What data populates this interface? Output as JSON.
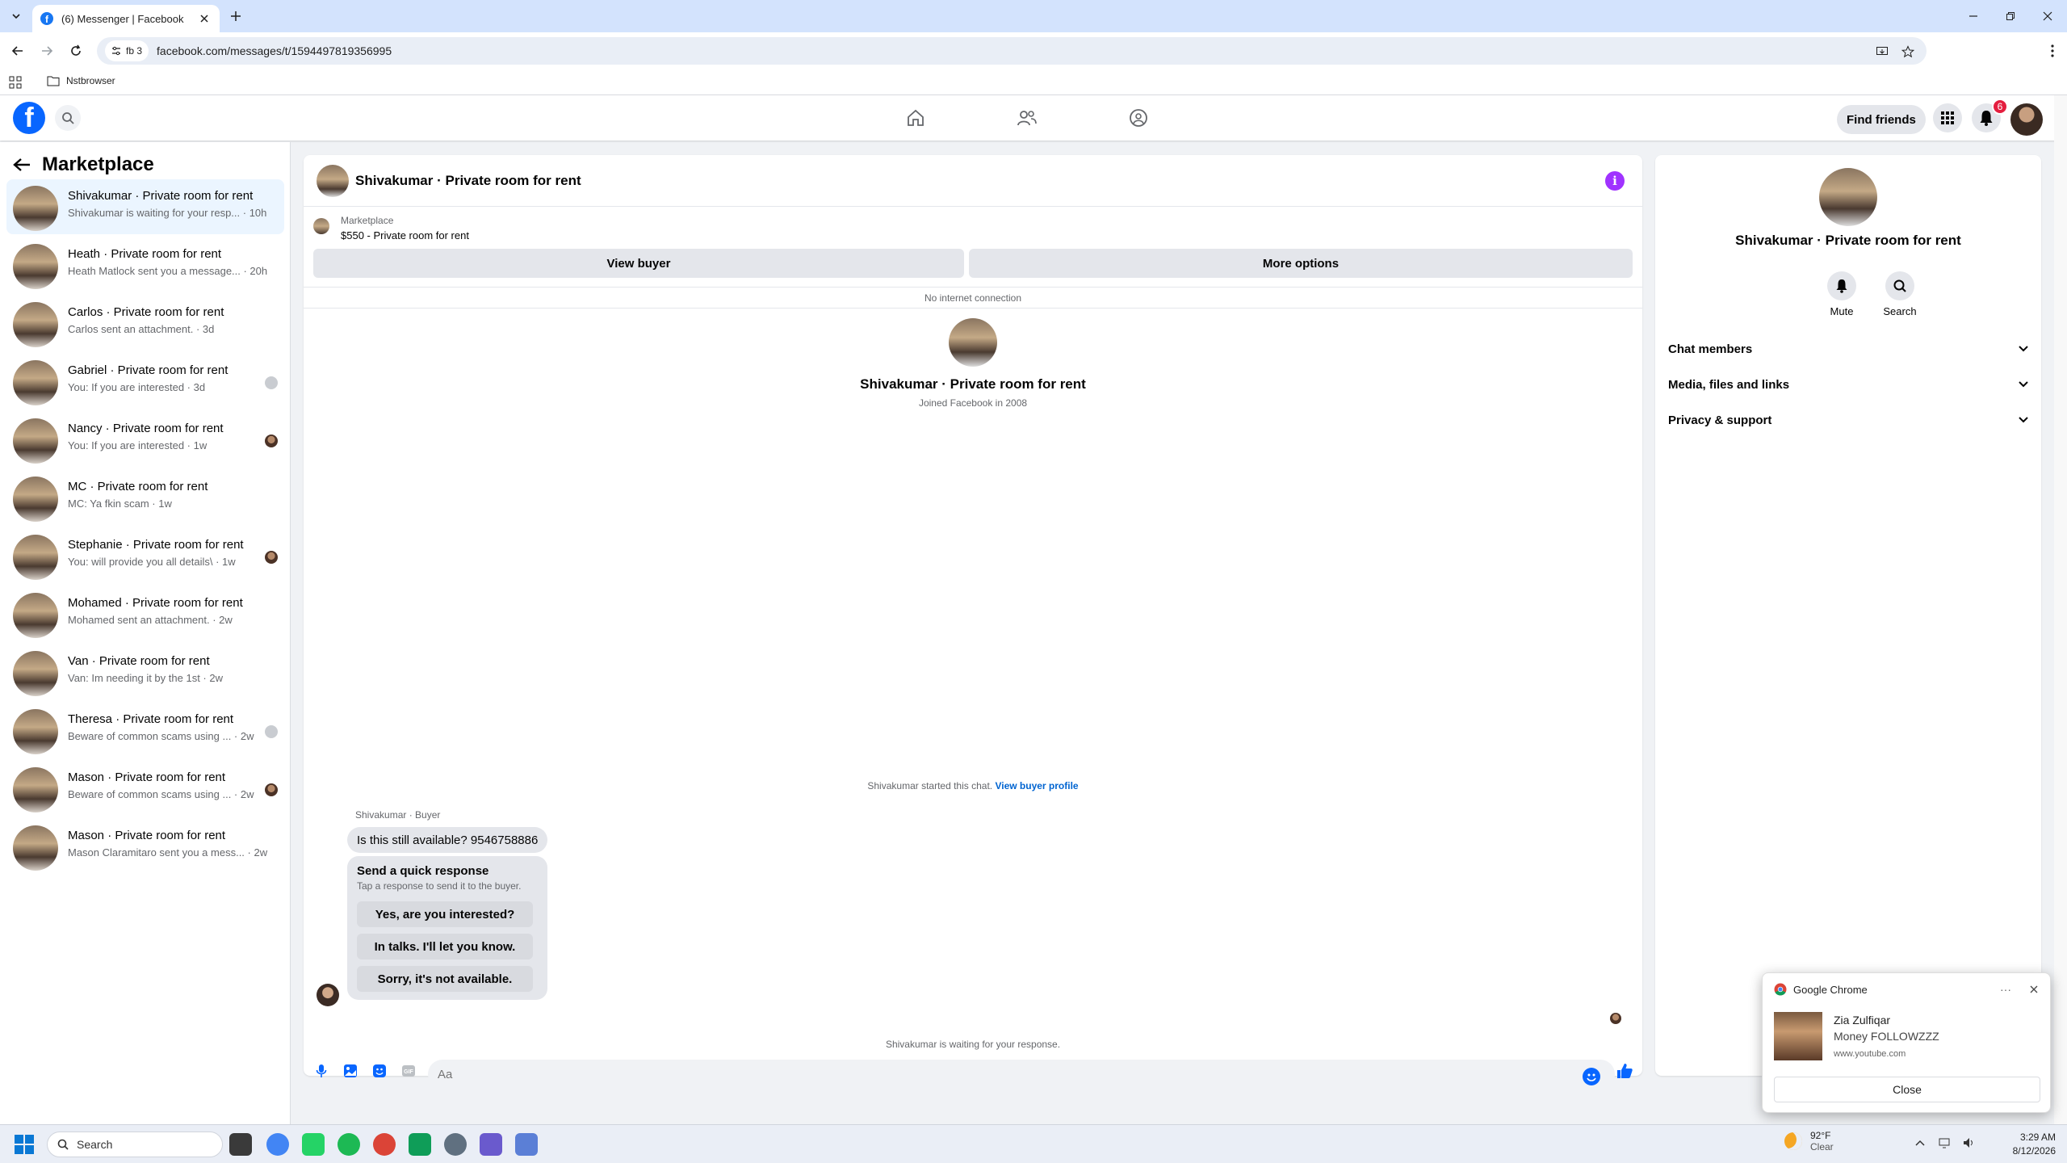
{
  "browser": {
    "tab_title": "(6) Messenger | Facebook",
    "site_chip": "fb 3",
    "url": "facebook.com/messages/t/1594497819356995",
    "bookmark_folder": "Nstbrowser"
  },
  "fb_header": {
    "logo_letter": "f",
    "find_friends_label": "Find friends",
    "notification_count": "6"
  },
  "sidebar": {
    "title": "Marketplace",
    "conversations": [
      {
        "name": "Shivakumar · Private room for rent",
        "snippet": "Shivakumar is waiting for your resp... · 10h",
        "active": true
      },
      {
        "name": "Heath · Private room for rent",
        "snippet": "Heath Matlock sent you a message... · 20h"
      },
      {
        "name": "Carlos · Private room for rent",
        "snippet": "Carlos sent an attachment. · 3d"
      },
      {
        "name": "Gabriel · Private room for rent",
        "snippet": "You: If you are interested · 3d"
      },
      {
        "name": "Nancy · Private room for rent",
        "snippet": "You: If you are interested · 1w"
      },
      {
        "name": "MC · Private room for rent",
        "snippet": "MC: Ya fkin scam · 1w"
      },
      {
        "name": "Stephanie · Private room for rent",
        "snippet": "You: will provide you all details\\ · 1w"
      },
      {
        "name": "Mohamed · Private room for rent",
        "snippet": "Mohamed sent an attachment. · 2w"
      },
      {
        "name": "Van · Private room for rent",
        "snippet": "Van: Im needing it by the 1st · 2w"
      },
      {
        "name": "Theresa · Private room for rent",
        "snippet": "Beware of common scams using ... · 2w"
      },
      {
        "name": "Mason · Private room for rent",
        "snippet": "Beware of common scams using ... · 2w"
      },
      {
        "name": "Mason · Private room for rent",
        "snippet": "Mason Claramitaro sent you a mess... · 2w"
      }
    ]
  },
  "chat": {
    "title": "Shivakumar · Private room for rent",
    "listing_source": "Marketplace",
    "listing_price_title": "$550 - Private room for rent",
    "view_buyer_label": "View buyer",
    "more_options_label": "More options",
    "connection_status": "No internet connection",
    "profile_name": "Shivakumar · Private room for rent",
    "joined": "Joined Facebook in 2008",
    "started_text": "Shivakumar started this chat.",
    "view_buyer_profile": "View buyer profile",
    "sender_label": "Shivakumar · Buyer",
    "message": "Is this still available? 9546758886",
    "quick_title": "Send a quick response",
    "quick_sub": "Tap a response to send it to the buyer.",
    "quick_replies": [
      "Yes, are you interested?",
      "In talks. I'll let you know.",
      "Sorry, it's not available."
    ],
    "waiting_text": "Shivakumar is waiting for your response.",
    "input_placeholder": "Aa"
  },
  "info_panel": {
    "name": "Shivakumar · Private room for rent",
    "mute_label": "Mute",
    "search_label": "Search",
    "sections": [
      "Chat members",
      "Media, files and links",
      "Privacy & support"
    ]
  },
  "notification": {
    "app": "Google Chrome",
    "title": "Zia Zulfiqar",
    "body": "Money FOLLOWZZZ",
    "source": "www.youtube.com",
    "close_label": "Close"
  },
  "taskbar": {
    "search_label": "Search",
    "temperature": "92°F",
    "weather": "Clear",
    "time": "3:29 AM",
    "date": "8/12/2026"
  },
  "colors": {
    "fb_blue": "#0866ff",
    "messenger_purple": "#a033ff",
    "badge_red": "#e41e3f"
  }
}
